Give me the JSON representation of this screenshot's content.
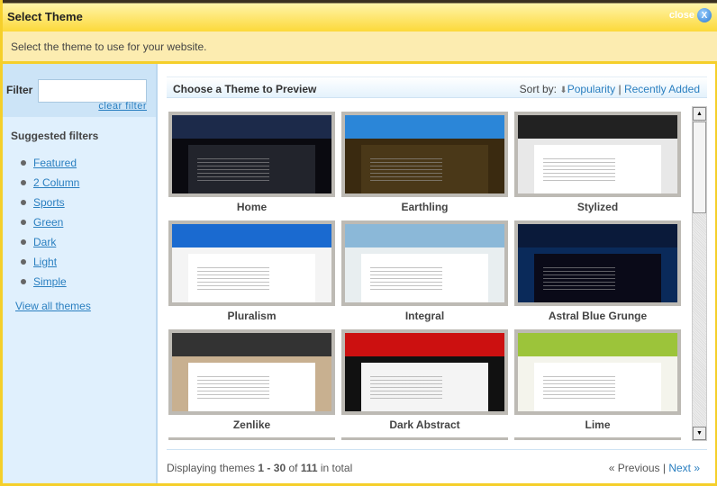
{
  "title": "Select Theme",
  "close_label": "close",
  "subtitle": "Select the theme to use for your website.",
  "filter": {
    "label": "Filter",
    "value": "",
    "clear": "clear filter"
  },
  "suggested": {
    "heading": "Suggested filters",
    "items": [
      "Featured",
      "2 Column",
      "Sports",
      "Green",
      "Dark",
      "Light",
      "Simple"
    ],
    "view_all": "View all themes"
  },
  "header": {
    "title": "Choose a Theme to Preview",
    "sort_label": "Sort by:",
    "sort_popularity": "Popularity",
    "sort_sep": "|",
    "sort_recent": "Recently Added"
  },
  "themes": [
    {
      "name": "Home",
      "bar": "#1c2a4a",
      "bg": "#0a0a10",
      "body": "#22242c"
    },
    {
      "name": "Earthling",
      "bar": "#2b86d8",
      "bg": "#3a2a10",
      "body": "#4a3818"
    },
    {
      "name": "Stylized",
      "bar": "#222",
      "bg": "#e8e8e8",
      "body": "#fff"
    },
    {
      "name": "Pluralism",
      "bar": "#1a6ad0",
      "bg": "#f4f4f4",
      "body": "#fff"
    },
    {
      "name": "Integral",
      "bar": "#8bb8d8",
      "bg": "#e8eef0",
      "body": "#fff"
    },
    {
      "name": "Astral Blue Grunge",
      "bar": "#0a1a3a",
      "bg": "#0a2a5a",
      "body": "#0a0a18"
    },
    {
      "name": "Zenlike",
      "bar": "#333",
      "bg": "#c8b090",
      "body": "#fff"
    },
    {
      "name": "Dark Abstract",
      "bar": "#cc1010",
      "bg": "#111",
      "body": "#f4f4f4"
    },
    {
      "name": "Lime",
      "bar": "#9cc43a",
      "bg": "#f4f4ec",
      "body": "#fff"
    }
  ],
  "footer": {
    "prefix": "Displaying themes",
    "start": "1",
    "dash": "-",
    "end": "30",
    "of": "of",
    "total": "111",
    "suffix": "in total",
    "prev": "« Previous",
    "sep": "|",
    "next": "Next »"
  }
}
